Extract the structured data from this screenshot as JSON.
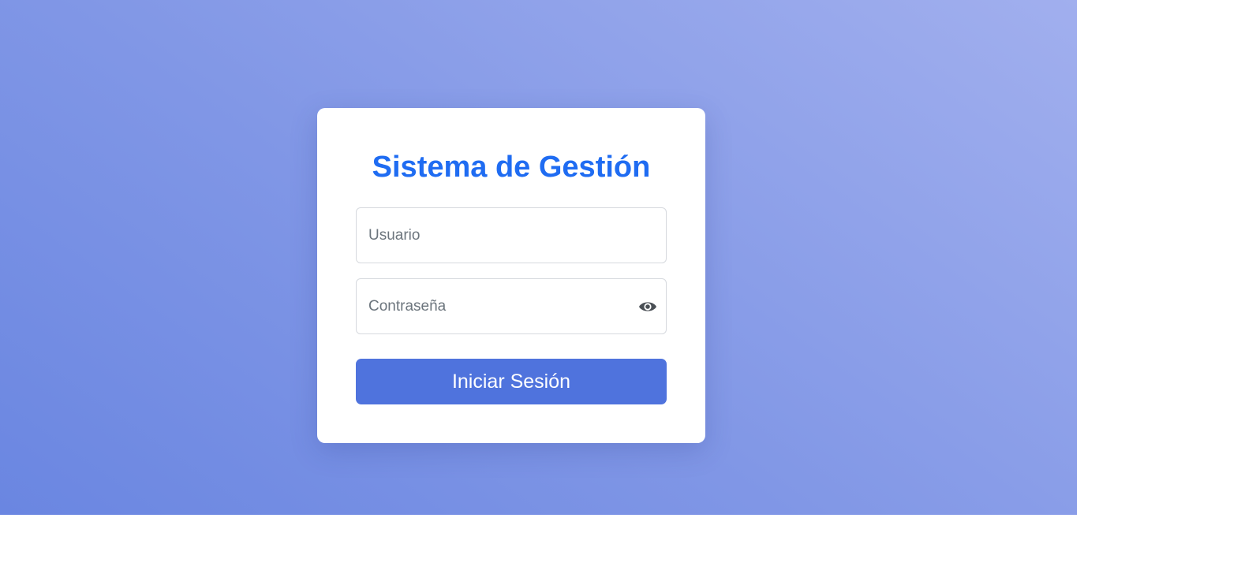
{
  "app": {
    "title": "Sistema de Gestión"
  },
  "login": {
    "username_placeholder": "Usuario",
    "username_value": "",
    "password_placeholder": "Contraseña",
    "password_value": "",
    "toggle_icon": "eye-icon",
    "submit_label": "Iniciar Sesión"
  },
  "colors": {
    "background_gradient_start": "#6a86e1",
    "background_gradient_end": "#a1afee",
    "title_color": "#1f6cf2",
    "button_color": "#4f73dd"
  }
}
